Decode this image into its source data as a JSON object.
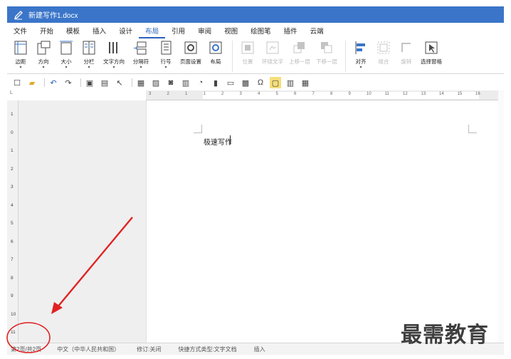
{
  "window": {
    "title": "新建写作1.docx"
  },
  "menu": {
    "items": [
      "文件",
      "开始",
      "模板",
      "插入",
      "设计",
      "布局",
      "引用",
      "审阅",
      "视图",
      "绘图笔",
      "插件",
      "云端"
    ],
    "active_index": 5
  },
  "ribbon": {
    "buttons": [
      {
        "label": "边距",
        "icon": "margins-icon",
        "dropdown": true,
        "enabled": true
      },
      {
        "label": "方向",
        "icon": "orientation-icon",
        "dropdown": true,
        "enabled": true
      },
      {
        "label": "大小",
        "icon": "page-size-icon",
        "dropdown": true,
        "enabled": true
      },
      {
        "label": "分栏",
        "icon": "columns-icon",
        "dropdown": true,
        "enabled": true
      },
      {
        "label": "文字方向",
        "icon": "text-direction-icon",
        "dropdown": true,
        "enabled": true
      },
      {
        "label": "分隔符",
        "icon": "separator-icon",
        "dropdown": true,
        "enabled": true
      },
      {
        "label": "行号",
        "icon": "line-number-icon",
        "dropdown": true,
        "enabled": true
      },
      {
        "label": "页面设置",
        "icon": "page-setup-icon",
        "dropdown": false,
        "enabled": true
      },
      {
        "label": "布局",
        "icon": "layout-icon",
        "dropdown": false,
        "enabled": true
      },
      {
        "label": "位置",
        "icon": "position-icon",
        "dropdown": false,
        "enabled": false
      },
      {
        "label": "环绕文字",
        "icon": "wrap-text-icon",
        "dropdown": false,
        "enabled": false
      },
      {
        "label": "上移一层",
        "icon": "bring-forward-icon",
        "dropdown": false,
        "enabled": false
      },
      {
        "label": "下移一层",
        "icon": "send-backward-icon",
        "dropdown": false,
        "enabled": false
      },
      {
        "label": "对齐",
        "icon": "align-icon",
        "dropdown": true,
        "enabled": true
      },
      {
        "label": "组合",
        "icon": "group-icon",
        "dropdown": false,
        "enabled": false
      },
      {
        "label": "旋转",
        "icon": "rotate-icon",
        "dropdown": false,
        "enabled": false
      },
      {
        "label": "选择窗格",
        "icon": "selection-pane-icon",
        "dropdown": false,
        "enabled": true
      }
    ]
  },
  "quick_toolbar": {
    "icons": [
      "new-doc-icon",
      "open-folder-icon",
      "undo-icon",
      "redo-icon",
      "save-icon",
      "print-icon",
      "pointer-icon",
      "table-icon",
      "image-icon",
      "screenshot-icon",
      "chart-icon",
      "shapes-icon",
      "bar-chart-icon",
      "textbox-icon",
      "field-icon",
      "symbol-icon",
      "note-icon",
      "columns-small-icon",
      "grid-icon"
    ]
  },
  "hruler": {
    "ticks": [
      "3",
      "2",
      "1",
      "1",
      "2",
      "3",
      "4",
      "5",
      "6",
      "7",
      "8",
      "9",
      "10",
      "11",
      "12",
      "13",
      "14",
      "15",
      "16"
    ]
  },
  "vruler": {
    "corner": "L",
    "ticks": [
      "1",
      "0",
      "1",
      "2",
      "3",
      "4",
      "5",
      "6",
      "7",
      "8",
      "9",
      "10",
      "11"
    ]
  },
  "document": {
    "text": "极速写作"
  },
  "statusbar": {
    "page": "第2页/共2页",
    "language": "中文（中华人民共和国）",
    "track": "修订:关闭",
    "shortcut": "快捷方式类型:文字文档",
    "mode": "插入"
  },
  "watermark": "最需教育",
  "colors": {
    "title_bar": "#3a75c9",
    "active_tab": "#2a62b8",
    "annotation": "#e02222"
  }
}
